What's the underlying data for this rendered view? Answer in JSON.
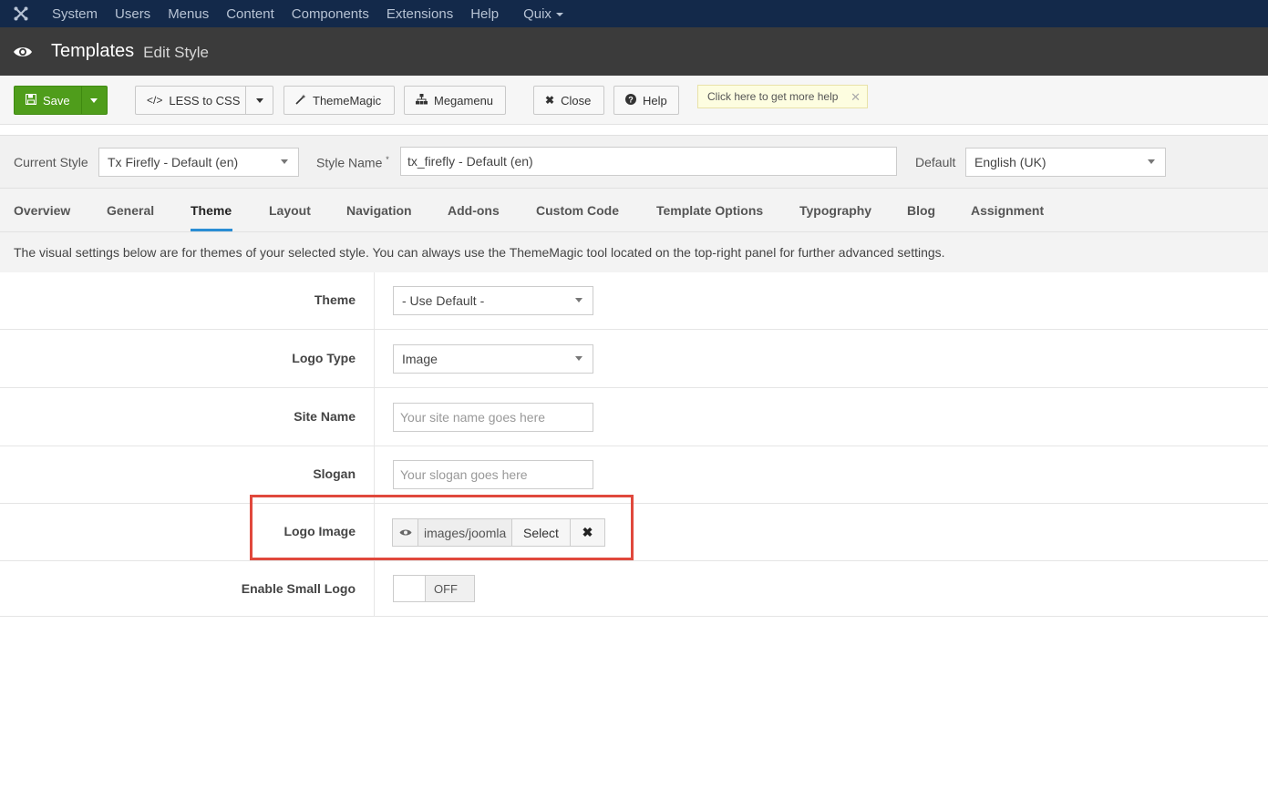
{
  "topnav": {
    "items": [
      "System",
      "Users",
      "Menus",
      "Content",
      "Components",
      "Extensions",
      "Help"
    ],
    "quix": "Quix"
  },
  "titlebar": {
    "title": "Templates",
    "subtitle": "Edit Style"
  },
  "toolbar": {
    "save": "Save",
    "less": "LESS to CSS",
    "thememagic": "ThemeMagic",
    "megamenu": "Megamenu",
    "close": "Close",
    "help": "Help",
    "helptip": "Click here to get more help"
  },
  "stylebar": {
    "current_style_label": "Current Style",
    "current_style_value": "Tx Firefly - Default (en)",
    "style_name_label": "Style Name",
    "style_name_required": "*",
    "style_name_value": "tx_firefly - Default (en)",
    "default_label": "Default",
    "default_value": "English (UK)"
  },
  "tabs": [
    "Overview",
    "General",
    "Theme",
    "Layout",
    "Navigation",
    "Add-ons",
    "Custom Code",
    "Template Options",
    "Typography",
    "Blog",
    "Assignment"
  ],
  "active_tab": "Theme",
  "info": "The visual settings below are for themes of your selected style. You can always use the ThemeMagic tool located on the top-right panel for further advanced settings.",
  "form": {
    "theme_label": "Theme",
    "theme_value": "- Use Default -",
    "logo_type_label": "Logo Type",
    "logo_type_value": "Image",
    "site_name_label": "Site Name",
    "site_name_placeholder": "Your site name goes here",
    "slogan_label": "Slogan",
    "slogan_placeholder": "Your slogan goes here",
    "logo_image_label": "Logo Image",
    "logo_image_path": "images/joomla",
    "logo_image_select": "Select",
    "small_logo_label": "Enable Small Logo",
    "small_logo_state": "OFF"
  },
  "colors": {
    "topnav": "#13294a",
    "save": "#4f9d1b",
    "tab_active": "#2a8dd4",
    "highlight": "#e0483c"
  }
}
